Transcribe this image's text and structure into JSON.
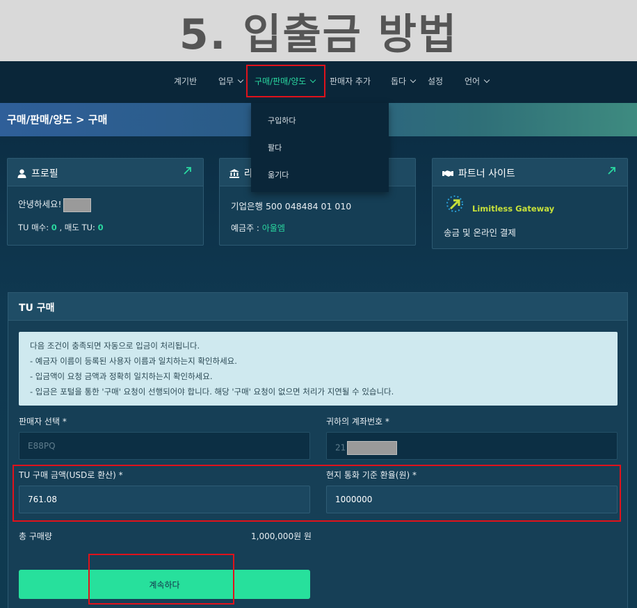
{
  "banner": {
    "title": "5. 입출금 방법"
  },
  "nav": {
    "items": [
      {
        "label": "계기반"
      },
      {
        "label": "업무"
      },
      {
        "label": "구매/판매/양도"
      },
      {
        "label": "판매자 추가"
      },
      {
        "label": "돕다"
      },
      {
        "label": "설정"
      },
      {
        "label": "언어"
      }
    ]
  },
  "breadcrumb": "구매/판매/양도 > 구매",
  "dropdown": {
    "items": [
      "구입하다",
      "팔다",
      "옮기다"
    ]
  },
  "profile_card": {
    "title": "프로필",
    "greeting": "안녕하세요!",
    "buy_label": "TU 매수: ",
    "buy_value": "0",
    "sep": " , 매도 TU: ",
    "sell_value": "0"
  },
  "bank_card": {
    "title_char": "라",
    "bank_line": "기업은행 500 048484 01 010",
    "holder_label": "예금주 : ",
    "holder_value": "아울엠"
  },
  "partner_card": {
    "title": "파트너 사이트",
    "logo_text": "Limitless Gateway",
    "subtitle": "송금 및 온라인 결제"
  },
  "purchase": {
    "title": "TU 구매",
    "notice": [
      "다음 조건이 충족되면 자동으로 입금이 처리됩니다.",
      "- 예금자 이름이 등록된 사용자 이름과 일치하는지 확인하세요.",
      "- 입금액이 요청 금액과 정확히 일치하는지 확인하세요.",
      "- 입금은 포털을 통한 '구매' 요청이 선행되어야 합니다. 해당 '구매' 요청이 없으면 처리가 지연될 수 있습니다."
    ],
    "seller_label": "판매자 선택 *",
    "seller_value": "E88PQ",
    "account_label": "귀하의 계좌번호 *",
    "account_value": "21",
    "amount_label": "TU 구매 금액(USD로 환산) *",
    "amount_value": "761.08",
    "rate_label": "현지 통화 기준 환율(원) *",
    "rate_value": "1000000",
    "total_label": "총 구매량",
    "total_value": "1,000,000원 원",
    "continue_label": "계속하다"
  },
  "colors": {
    "accent": "#2ad8a0",
    "highlight": "#e0121b",
    "button": "#27e09c"
  }
}
